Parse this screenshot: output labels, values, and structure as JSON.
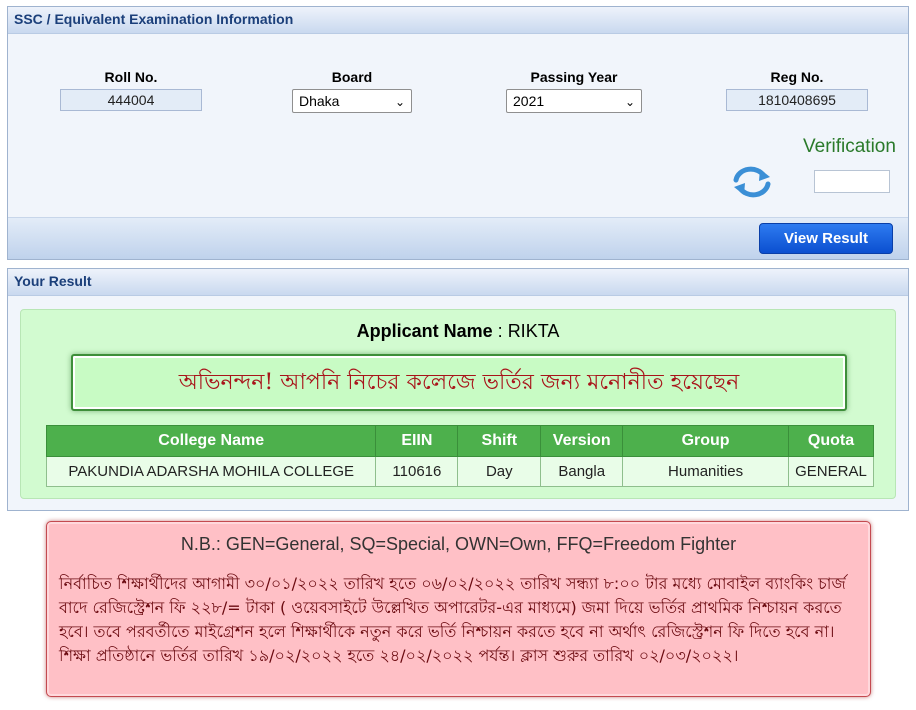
{
  "ssc_panel": {
    "title": "SSC / Equivalent Examination Information",
    "roll_label": "Roll No.",
    "roll_value": "444004",
    "board_label": "Board",
    "board_value": "Dhaka",
    "year_label": "Passing Year",
    "year_value": "2021",
    "reg_label": "Reg No.",
    "reg_value": "1810408695",
    "verification_label": "Verification",
    "verification_value": "",
    "view_button": "View Result"
  },
  "result_panel": {
    "title": "Your Result",
    "applicant_label": "Applicant Name",
    "applicant_sep": " : ",
    "applicant_name": "RIKTA",
    "congrats": "অভিনন্দন! আপনি নিচের কলেজে ভর্তির জন্য মনোনীত হয়েছেন",
    "table": {
      "headers": [
        "College Name",
        "EIIN",
        "Shift",
        "Version",
        "Group",
        "Quota"
      ],
      "row": [
        "PAKUNDIA ADARSHA MOHILA COLLEGE",
        "110616",
        "Day",
        "Bangla",
        "Humanities",
        "GENERAL"
      ]
    }
  },
  "notice": {
    "title": "N.B.: GEN=General, SQ=Special, OWN=Own, FFQ=Freedom Fighter",
    "text": "নির্বাচিত শিক্ষার্থীদের আগামী ৩০/০১/২০২২ তারিখ হতে ০৬/০২/২০২২ তারিখ সন্ধ্যা ৮:০০ টার মধ্যে মোবাইল ব্যাংকিং চার্জ বাদে রেজিস্ট্রেশন ফি ২২৮/= টাকা ( ওয়েবসাইটে উল্লেখিত অপারেটর-এর মাধ্যমে) জমা দিয়ে ভর্তির প্রাথমিক নিশ্চায়ন করতে হবে। তবে পরবর্তীতে মাইগ্রেশন হলে শিক্ষার্থীকে নতুন করে ভর্তি নিশ্চায়ন করতে হবে না অর্থাৎ রেজিস্ট্রেশন ফি দিতে হবে না। শিক্ষা প্রতিষ্ঠানে ভর্তির তারিখ ১৯/০২/২০২২ হতে ২৪/০২/২০২২ পর্যন্ত। ক্লাস শুরুর তারিখ ০২/০৩/২০২২।"
  },
  "colors": {
    "panel_header_text": "#1b3f7a",
    "button_blue": "#0b4fd0",
    "table_header_green": "#4db04c",
    "congrats_red": "#a8141a",
    "notice_pink": "#ffc0c6"
  },
  "icons": [
    "refresh-icon",
    "chevron-down-icon"
  ]
}
